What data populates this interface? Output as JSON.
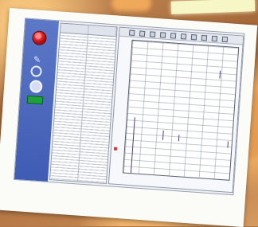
{
  "scene": {
    "accent_red": "#e02828",
    "panel_blue": "#4e6bbf",
    "status_green": "#1fa13a"
  },
  "app": {
    "sidebar": {
      "icons": [
        "record-icon",
        "wrench-icon",
        "ring-icon",
        "settings-icon",
        "status-led-icon"
      ]
    },
    "channel_list": {
      "columns": [
        "",
        ""
      ],
      "row_count": 48
    },
    "plot": {
      "toolbar_icons": [
        "zoom-icon",
        "zoom-out-icon",
        "pan-icon",
        "cursor-icon",
        "grid-icon",
        "scale-icon",
        "print-icon",
        "copy-icon",
        "save-icon",
        "settings-icon"
      ],
      "y_axis_label": "",
      "x_axis_label": "",
      "y_ticks": [
        "",
        "",
        "",
        "",
        "",
        "",
        "",
        "",
        "",
        "",
        "",
        ""
      ],
      "x_ticks": [
        "",
        "",
        "",
        "",
        "",
        ""
      ],
      "grid": true
    }
  }
}
